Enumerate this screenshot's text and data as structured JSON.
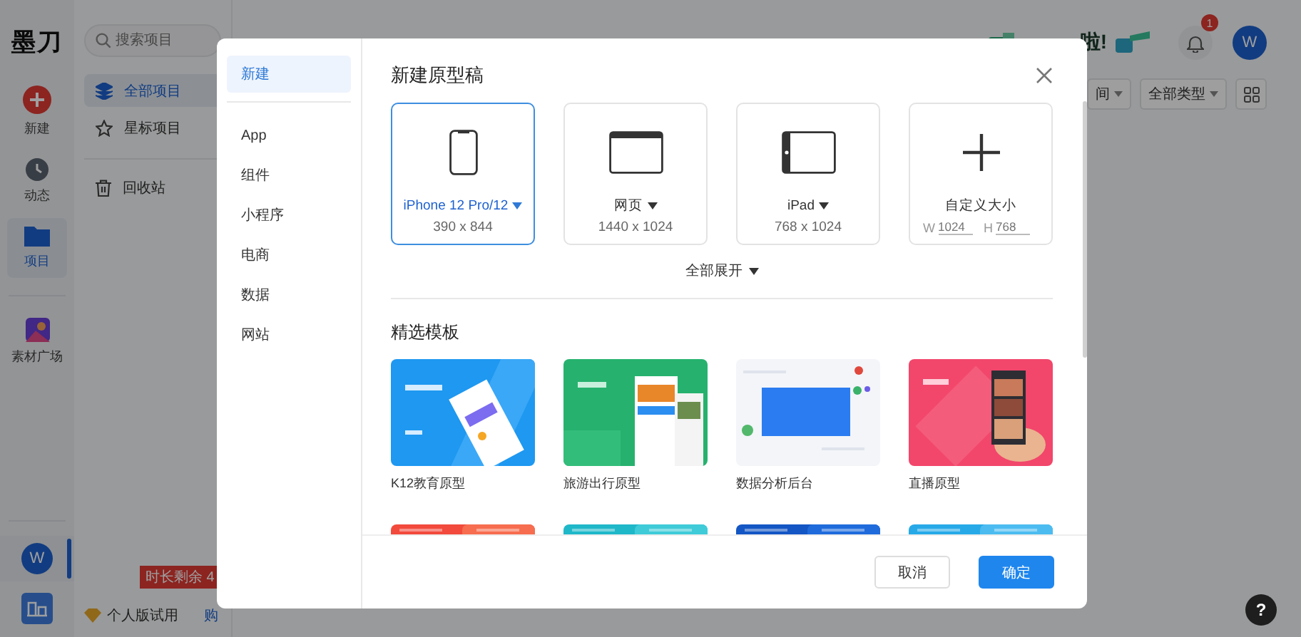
{
  "rail": {
    "logo": "墨刀",
    "items": [
      {
        "label": "新建",
        "kind": "new",
        "selected": false
      },
      {
        "label": "动态",
        "kind": "activity",
        "selected": false
      },
      {
        "label": "项目",
        "kind": "projects",
        "selected": true
      },
      {
        "label": "素材广场",
        "kind": "assets",
        "selected": false
      }
    ],
    "avatar": "W"
  },
  "sidebar": {
    "search_placeholder": "搜索项目",
    "items": [
      {
        "label": "全部项目",
        "kind": "all",
        "selected": true
      },
      {
        "label": "星标项目",
        "kind": "star",
        "selected": false
      },
      {
        "label": "回收站",
        "kind": "trash",
        "selected": false
      }
    ],
    "plan": "个人版试用",
    "buy_link": "购",
    "tooltip": "时长剩余 4"
  },
  "header": {
    "banner": "啦!",
    "notifications": "1",
    "avatar": "W",
    "filters": [
      {
        "label": "间"
      },
      {
        "label": "全部类型"
      }
    ]
  },
  "dialog": {
    "nav": [
      {
        "label": "新建",
        "selected": true
      },
      {
        "label": "App",
        "selected": false
      },
      {
        "label": "组件",
        "selected": false
      },
      {
        "label": "小程序",
        "selected": false
      },
      {
        "label": "电商",
        "selected": false
      },
      {
        "label": "数据",
        "selected": false
      },
      {
        "label": "网站",
        "selected": false
      }
    ],
    "title": "新建原型稿",
    "devices": [
      {
        "kind": "phone",
        "label": "iPhone 12 Pro/12",
        "size": "390 x 844",
        "dropdown": true,
        "selected": true
      },
      {
        "kind": "browser",
        "label": "网页",
        "size": "1440 x 1024",
        "dropdown": true,
        "selected": false
      },
      {
        "kind": "tablet",
        "label": "iPad",
        "size": "768 x 1024",
        "dropdown": true,
        "selected": false
      },
      {
        "kind": "custom",
        "label": "自定义大小",
        "dropdown": false,
        "selected": false,
        "fields": [
          {
            "label": "W",
            "placeholder": "1024"
          },
          {
            "label": "H",
            "placeholder": "768"
          }
        ]
      }
    ],
    "expand_all": "全部展开",
    "templates_title": "精选模板",
    "templates": [
      {
        "title": "K12教育原型",
        "kind": "picture"
      },
      {
        "title": "旅游出行原型",
        "kind": "picture"
      },
      {
        "title": "数据分析后台",
        "kind": "picture"
      },
      {
        "title": "直播原型",
        "kind": "picture"
      }
    ],
    "buttons": [
      {
        "label": "取消",
        "kind": "secondary"
      },
      {
        "label": "确定",
        "kind": "primary"
      }
    ]
  },
  "help": "?"
}
